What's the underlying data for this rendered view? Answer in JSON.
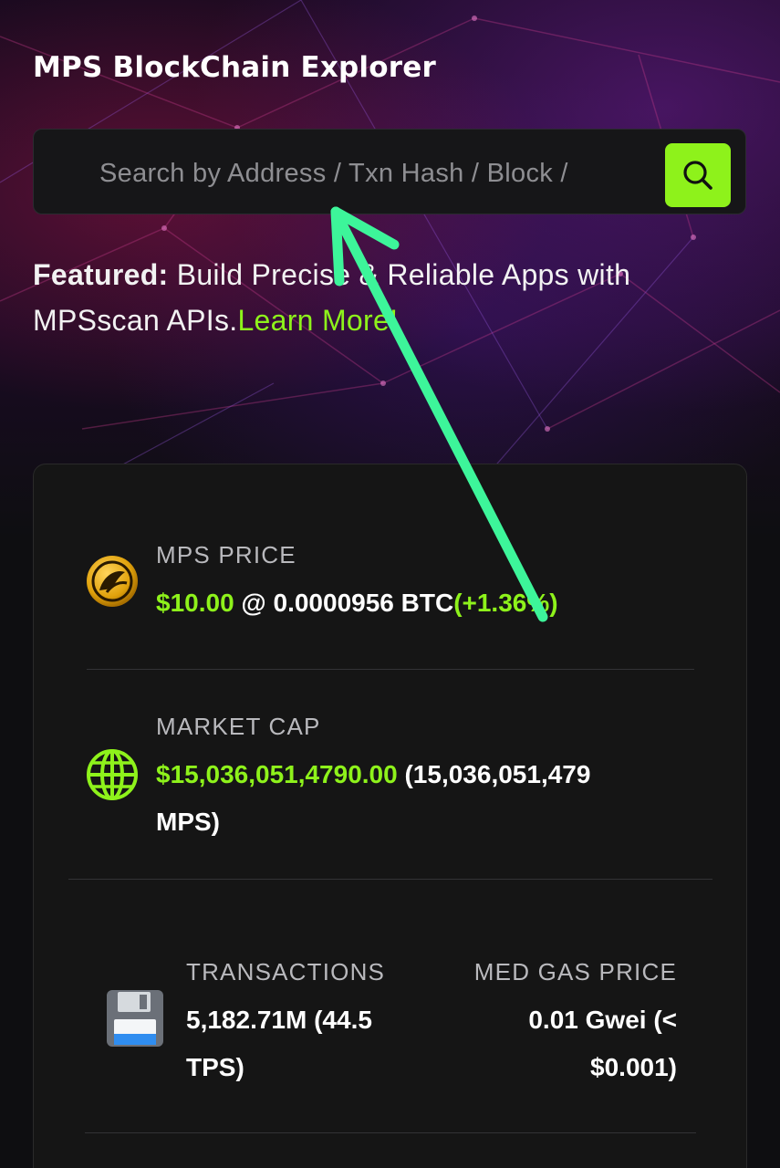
{
  "header": {
    "title": "MPS BlockChain Explorer"
  },
  "search": {
    "placeholder": "Search by Address / Txn Hash / Block /",
    "button_icon": "search-icon"
  },
  "featured": {
    "prefix": "Featured:",
    "text": " Build Precise & Reliable Apps with MPSscan APIs.",
    "link": "Learn More!"
  },
  "stats": {
    "price": {
      "label": "MPS PRICE",
      "usd": "$10.00",
      "btc": " @ 0.0000956 BTC",
      "change": "(+1.36%)",
      "icon": "mps-coin-icon"
    },
    "market_cap": {
      "label": "MARKET CAP",
      "usd": "$15,036,051,4790.00",
      "line1_rest": " (15,036,051,479",
      "line2": "MPS)",
      "icon": "globe-icon"
    },
    "transactions": {
      "label": "TRANSACTIONS",
      "line1": "5,182.71M (44.5",
      "line2": "TPS)",
      "icon": "floppy-disk-icon"
    },
    "gas": {
      "label": "MED GAS PRICE",
      "line1": "0.01 Gwei (<",
      "line2": "$0.001)"
    }
  },
  "colors": {
    "accent": "#8ef21b",
    "annotation_arrow": "#3df59a",
    "card_bg": "#151515"
  }
}
